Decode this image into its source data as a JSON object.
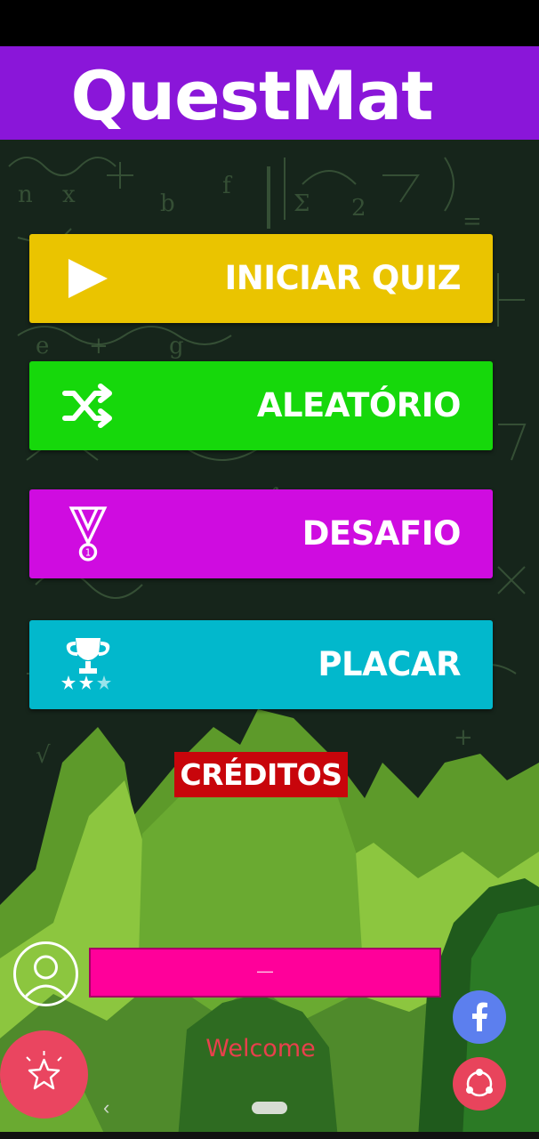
{
  "app": {
    "title": "QuestMat"
  },
  "menu": [
    {
      "id": "start",
      "label": "INICIAR QUIZ",
      "icon": "play-icon",
      "color": "#eac400"
    },
    {
      "id": "random",
      "label": "ALEATÓRIO",
      "icon": "shuffle-icon",
      "color": "#16d80b"
    },
    {
      "id": "challenge",
      "label": "DESAFIO",
      "icon": "medal-icon",
      "color": "#cf0ce0"
    },
    {
      "id": "scoreboard",
      "label": "PLACAR",
      "icon": "trophy-icon",
      "color": "#02b8cc"
    }
  ],
  "credits": {
    "label": "CRÉDITOS",
    "color": "#c8050b"
  },
  "user": {
    "avatar_icon": "user-avatar-icon",
    "name": "—",
    "bar_color": "#ff009a"
  },
  "footer": {
    "welcome": "Welcome",
    "rate_icon": "star-icon",
    "facebook_icon": "facebook-icon",
    "share_icon": "share-icon"
  },
  "theme": {
    "header": "#8a16d9",
    "board": "#16251b",
    "accent": "#ea4560"
  }
}
